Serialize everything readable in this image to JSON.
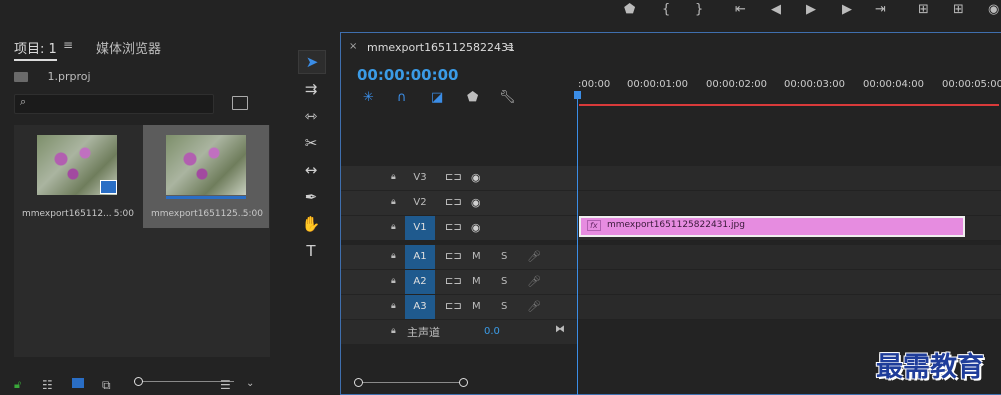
{
  "accent_color": "#3b8de6",
  "clip_color": "#e68ce0",
  "playhead_color": "#3b8de6",
  "project": {
    "tab_label": "项目: 1",
    "tab2_label": "媒体浏览器",
    "file_name": "1.prproj",
    "search_placeholder": "",
    "clips": [
      {
        "name": "mmexport165112...",
        "duration": "5:00"
      },
      {
        "name": "mmexport1651125...",
        "duration": "5:00"
      }
    ]
  },
  "timeline": {
    "sequence_name": "mmexport1651125822431",
    "timecode": "00:00:00:00",
    "ruler": [
      ":00:00",
      "00:00:01:00",
      "00:00:02:00",
      "00:00:03:00",
      "00:00:04:00",
      "00:00:05:00"
    ],
    "tracks": {
      "video": [
        "V3",
        "V2",
        "V1"
      ],
      "audio": [
        "A1",
        "A2",
        "A3"
      ],
      "mute_label": "M",
      "solo_label": "S"
    },
    "master": {
      "label": "主声道",
      "value": "0.0"
    },
    "clip": {
      "fx_label": "fx",
      "name": "mmexport1651125822431.jpg"
    }
  },
  "watermark": "最需教育"
}
